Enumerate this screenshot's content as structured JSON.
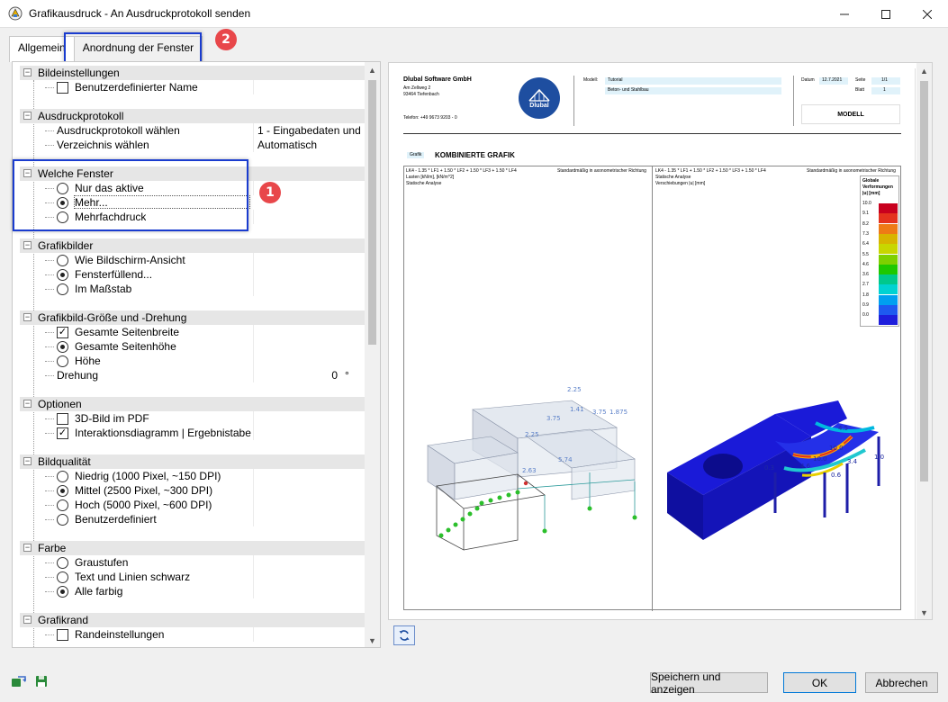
{
  "window": {
    "title": "Grafikausdruck - An Ausdruckprotokoll senden",
    "icons": {
      "app": "printer-graphic-icon",
      "minimize": "minimize-icon",
      "maximize": "maximize-icon",
      "close": "close-icon"
    }
  },
  "tabs": [
    {
      "label": "Allgemein",
      "active": true
    },
    {
      "label": "Anordnung der Fenster",
      "active": false
    }
  ],
  "callouts": [
    "1",
    "2"
  ],
  "groups": {
    "bildeinstellungen": {
      "title": "Bildeinstellungen",
      "items": {
        "benutzerdefinierter_name": "Benutzerdefinierter Name"
      }
    },
    "ausdruckprotokoll": {
      "title": "Ausdruckprotokoll",
      "rows": [
        {
          "label": "Ausdruckprotokoll wählen",
          "value": "1 - Eingabedaten und ..."
        },
        {
          "label": "Verzeichnis wählen",
          "value": "Automatisch"
        }
      ]
    },
    "welche_fenster": {
      "title": "Welche Fenster",
      "options": [
        "Nur das aktive",
        "Mehr...",
        "Mehrfachdruck"
      ],
      "selected": 1
    },
    "grafikbilder": {
      "title": "Grafikbilder",
      "options": [
        "Wie Bildschirm-Ansicht",
        "Fensterfüllend...",
        "Im Maßstab"
      ],
      "selected": 1
    },
    "groesse": {
      "title": "Grafikbild-Größe und -Drehung",
      "gesamte_seitenbreite": "Gesamte Seitenbreite",
      "gesamte_seitenhoehe": "Gesamte Seitenhöhe",
      "hoehe": "Höhe",
      "drehung_label": "Drehung",
      "drehung_value": "0",
      "drehung_unit": "°"
    },
    "optionen": {
      "title": "Optionen",
      "items": [
        "3D-Bild im PDF",
        "Interaktionsdiagramm | Ergebnistabe"
      ],
      "checked": [
        false,
        true
      ]
    },
    "bildqualitaet": {
      "title": "Bildqualität",
      "options": [
        "Niedrig (1000 Pixel, ~150 DPI)",
        "Mittel (2500 Pixel, ~300 DPI)",
        "Hoch (5000 Pixel, ~600 DPI)",
        "Benutzerdefiniert"
      ],
      "selected": 1
    },
    "farbe": {
      "title": "Farbe",
      "options": [
        "Graustufen",
        "Text und Linien schwarz",
        "Alle farbig"
      ],
      "selected": 2
    },
    "grafikrand": {
      "title": "Grafikrand",
      "items": {
        "randeinstellungen": "Randeinstellungen"
      }
    }
  },
  "preview": {
    "company": "Dlubal Software GmbH",
    "address1": "Am Zellweg 2",
    "address2": "93464 Tiefenbach",
    "phone": "Telefon: +49 9673 9203 - 0",
    "logo_text": "Dlubal",
    "modell_label": "Modell:",
    "modell_value": "Tutorial",
    "modell_value2": "Beton- und Stahlbau",
    "datum_label": "Datum",
    "datum_value": "12.7.2021",
    "seite_label": "Seite",
    "seite_value": "1/1",
    "blatt_label": "Blatt",
    "blatt_value": "1",
    "modell_box": "MODELL",
    "grafik_tag": "Grafik",
    "section_title": "KOMBINIERTE GRAFIK",
    "left_caption1": "LK4 - 1.35 * LF1 + 1.50 * LF2 + 1.50 * LF3 + 1.50 * LF4",
    "left_caption2": "Lasten [kN/m], [kN/m^2]",
    "left_caption3": "Statische Analyse",
    "left_caption_right": "Standardmäßig in axonometrischer Richtung",
    "right_caption1": "LK4 - 1.35 * LF1 + 1.50 * LF2 + 1.50 * LF3 + 1.50 * LF4",
    "right_caption2": "Statische Analyse",
    "right_caption3": "Verschiebungen |u| [mm]",
    "right_caption_right": "Standardmäßig in axonometrischer Richtung",
    "legend_title1": "Globale",
    "legend_title2": "Verformungen",
    "legend_title3": "|u| [mm]",
    "legend_values": [
      "10.0",
      "9.1",
      "8.2",
      "7.3",
      "6.4",
      "5.5",
      "4.6",
      "3.6",
      "2.7",
      "1.8",
      "0.9",
      "0.0"
    ],
    "legend_colors": [
      "#c8001e",
      "#e4321e",
      "#ee7a16",
      "#d8b400",
      "#c8d600",
      "#7ed000",
      "#1ec800",
      "#00c88c",
      "#00d2d2",
      "#00a0f0",
      "#1e5af0",
      "#1e1edc"
    ],
    "load_labels": [
      "2.25",
      "1.875",
      "3.75",
      "1.41",
      "2.25",
      "3.75",
      "5.74",
      "2.63"
    ],
    "disp_labels": [
      "4.5",
      "10.0",
      "10.0",
      "3.4",
      "4.6",
      "0.6",
      "1.0",
      "0.3"
    ]
  },
  "bottom": {
    "icons": [
      "import-settings-icon",
      "save-settings-icon"
    ],
    "save_show": "Speichern und anzeigen",
    "ok": "OK",
    "cancel": "Abbrechen"
  }
}
